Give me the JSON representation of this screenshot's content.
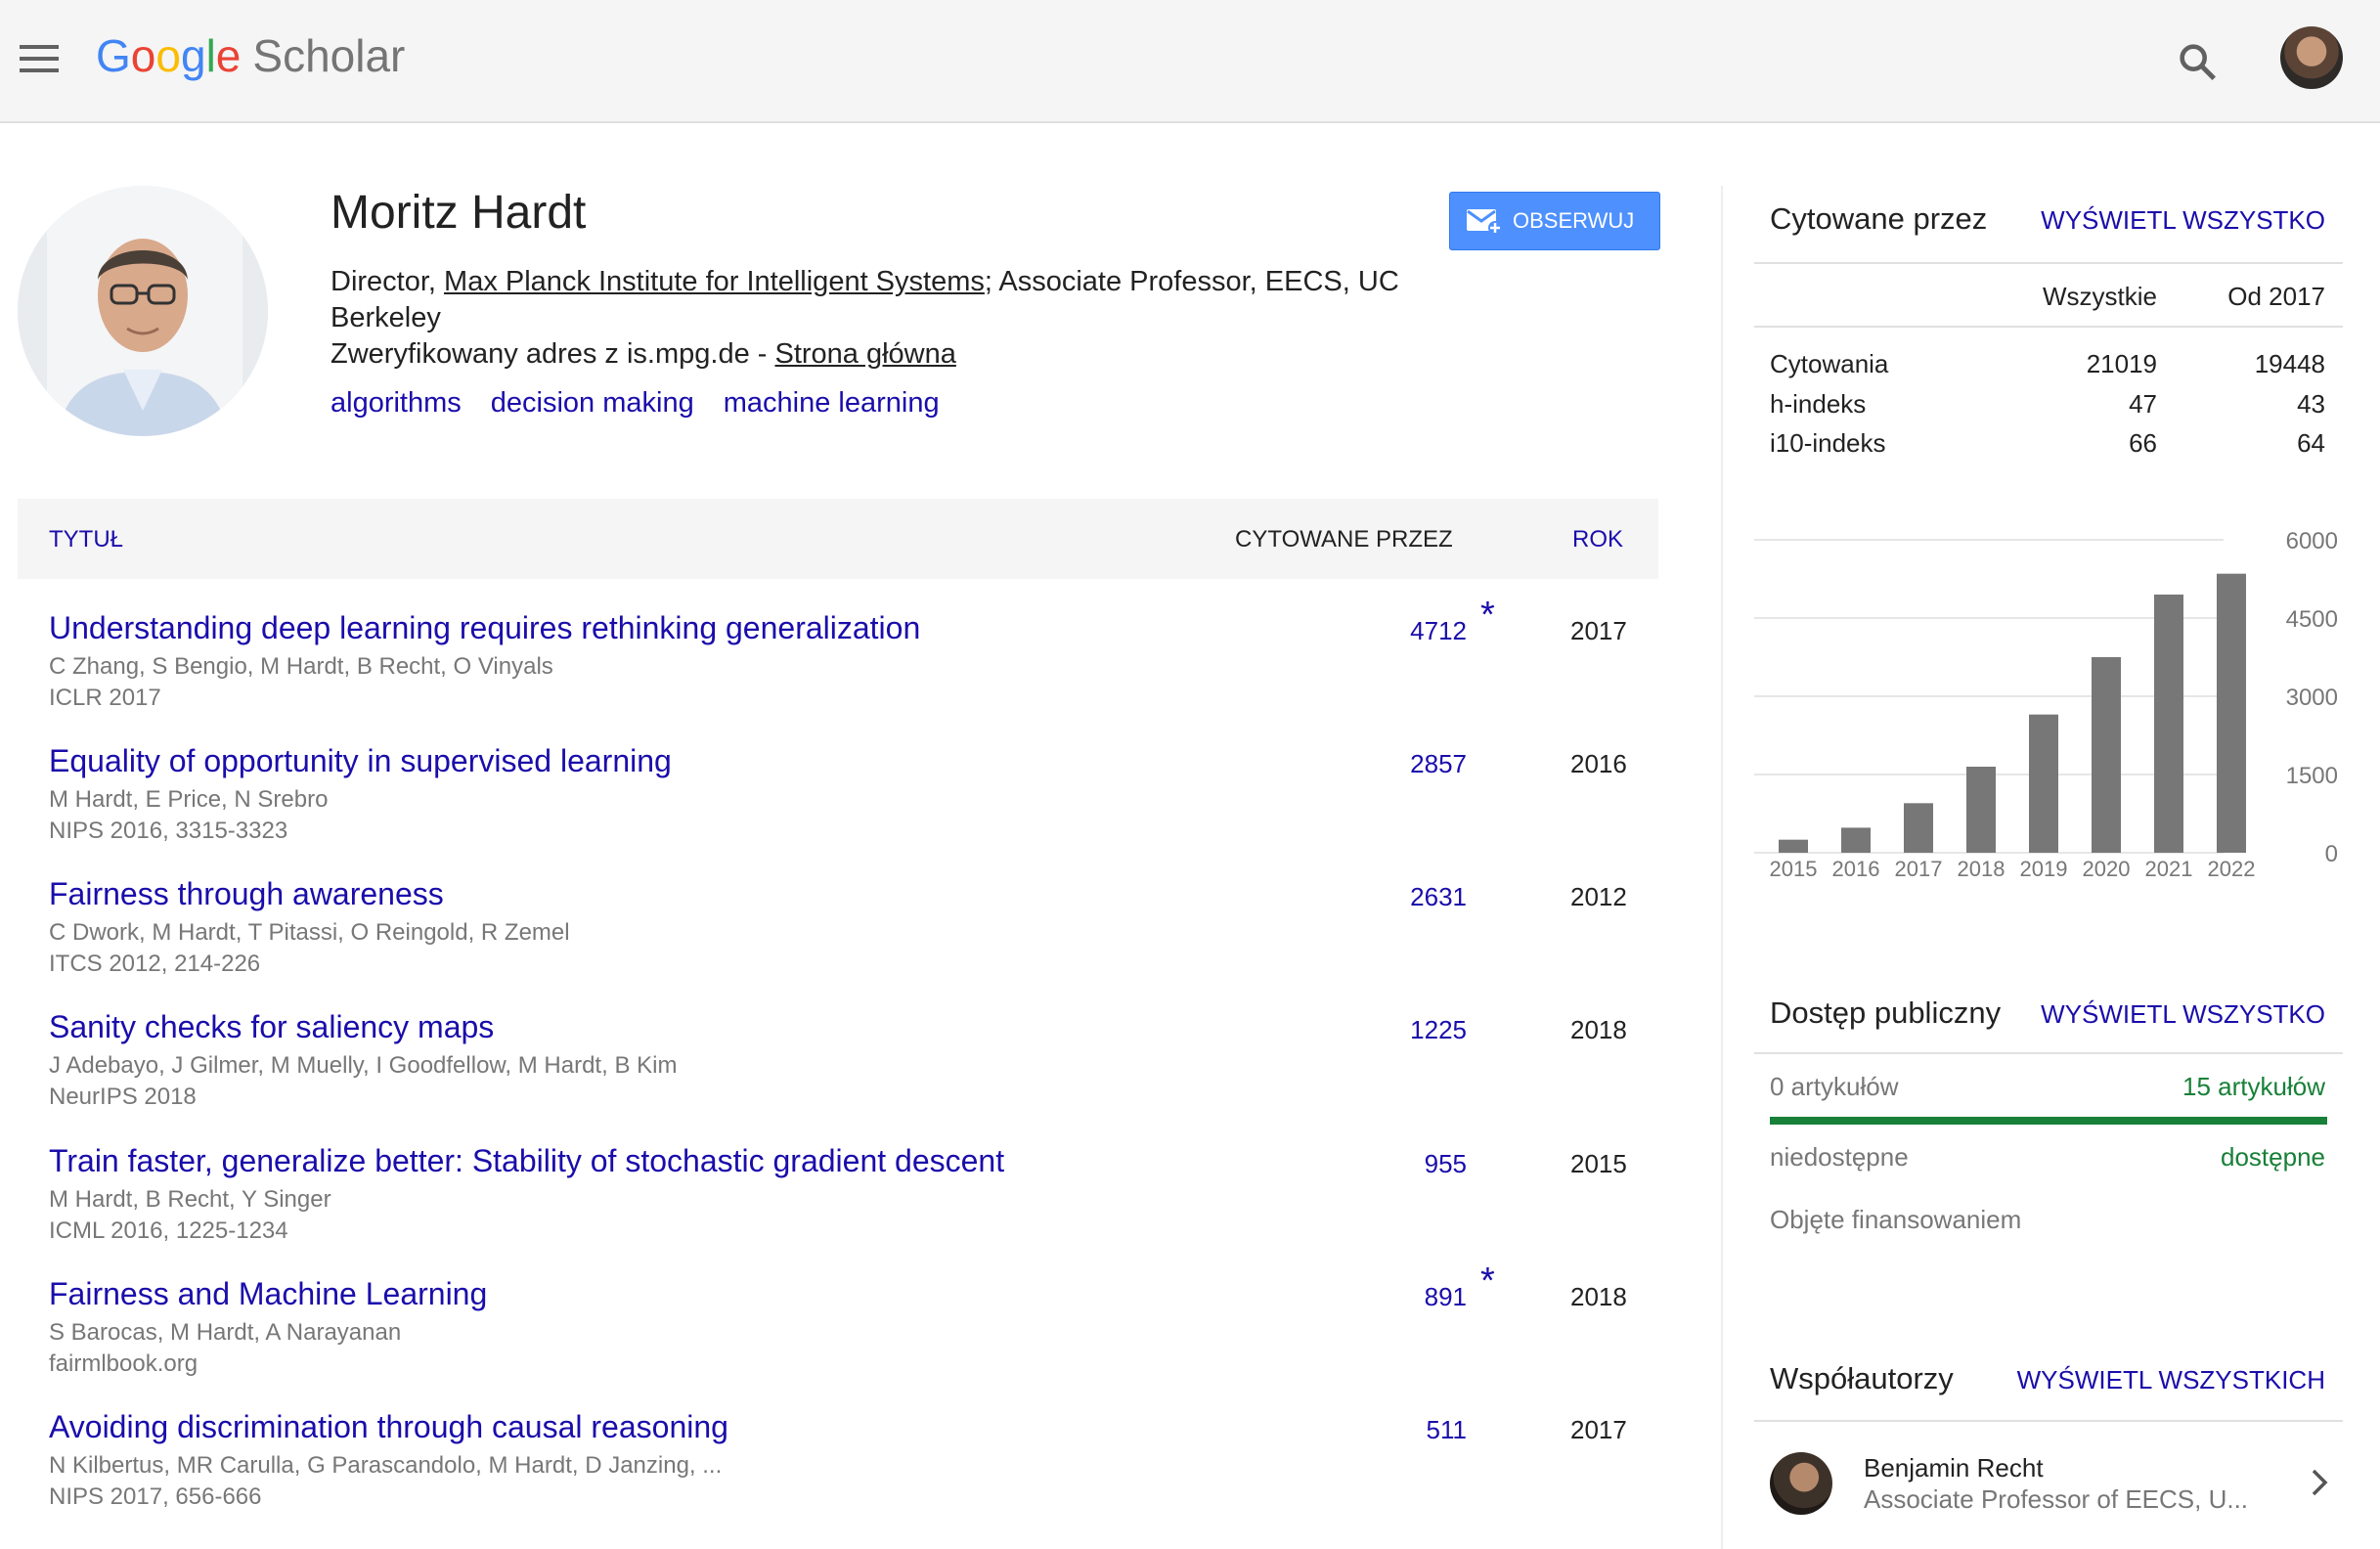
{
  "header": {
    "logo": [
      "G",
      "o",
      "o",
      "g",
      "l",
      "e"
    ],
    "logo_suffix": "Scholar"
  },
  "profile": {
    "name": "Moritz Hardt",
    "affil_prefix": "Director, ",
    "affil_link": "Max Planck Institute for Intelligent Systems",
    "affil_suffix": "; Associate Professor, EECS, UC Berkeley",
    "verified_text": "Zweryfikowany adres z is.mpg.de - ",
    "homepage_link": "Strona główna",
    "interests": [
      "algorithms",
      "decision making",
      "machine learning"
    ],
    "follow_label": "OBSERWUJ"
  },
  "table": {
    "col_title": "TYTUŁ",
    "col_cited": "CYTOWANE PRZEZ",
    "col_year": "ROK",
    "rows": [
      {
        "title": "Understanding deep learning requires rethinking generalization",
        "authors": "C Zhang, S Bengio, M Hardt, B Recht, O Vinyals",
        "venue": "ICLR 2017",
        "cited": "4712",
        "star": "*",
        "year": "2017"
      },
      {
        "title": "Equality of opportunity in supervised learning",
        "authors": "M Hardt, E Price, N Srebro",
        "venue": "NIPS 2016, 3315-3323",
        "cited": "2857",
        "star": "",
        "year": "2016"
      },
      {
        "title": "Fairness through awareness",
        "authors": "C Dwork, M Hardt, T Pitassi, O Reingold, R Zemel",
        "venue": "ITCS 2012, 214-226",
        "cited": "2631",
        "star": "",
        "year": "2012"
      },
      {
        "title": "Sanity checks for saliency maps",
        "authors": "J Adebayo, J Gilmer, M Muelly, I Goodfellow, M Hardt, B Kim",
        "venue": "NeurIPS 2018",
        "cited": "1225",
        "star": "",
        "year": "2018"
      },
      {
        "title": "Train faster, generalize better: Stability of stochastic gradient descent",
        "authors": "M Hardt, B Recht, Y Singer",
        "venue": "ICML 2016, 1225-1234",
        "cited": "955",
        "star": "",
        "year": "2015"
      },
      {
        "title": "Fairness and Machine Learning",
        "authors": "S Barocas, M Hardt, A Narayanan",
        "venue": "fairmlbook.org",
        "cited": "891",
        "star": "*",
        "year": "2018"
      },
      {
        "title": "Avoiding discrimination through causal reasoning",
        "authors": "N Kilbertus, MR Carulla, G Parascandolo, M Hardt, D Janzing, ...",
        "venue": "NIPS 2017, 656-666",
        "cited": "511",
        "star": "",
        "year": "2017"
      }
    ]
  },
  "cited_by": {
    "heading": "Cytowane przez",
    "view_all": "WYŚWIETL WSZYSTKO",
    "col_all": "Wszystkie",
    "col_since": "Od 2017",
    "stats": [
      {
        "label": "Cytowania",
        "all": "21019",
        "since": "19448"
      },
      {
        "label": "h-indeks",
        "all": "47",
        "since": "43"
      },
      {
        "label": "i10-indeks",
        "all": "66",
        "since": "64"
      }
    ]
  },
  "chart_data": {
    "type": "bar",
    "categories": [
      "2015",
      "2016",
      "2017",
      "2018",
      "2019",
      "2020",
      "2021",
      "2022"
    ],
    "values": [
      250,
      480,
      950,
      1650,
      2650,
      3750,
      4950,
      5350
    ],
    "ylim": [
      0,
      6000
    ],
    "yticks": [
      "6000",
      "4500",
      "3000",
      "1500",
      "0"
    ],
    "bar_color": "#777777",
    "grid": true
  },
  "open_access": {
    "heading": "Dostęp publiczny",
    "view_all": "WYŚWIETL WSZYSTKO",
    "left_count": "0 artykułów",
    "right_count": "15 artykułów",
    "left_label": "niedostępne",
    "right_label": "dostępne",
    "funding": "Objęte finansowaniem",
    "accent": "#188038"
  },
  "coauthors": {
    "heading": "Współautorzy",
    "view_all": "WYŚWIETL WSZYSTKICH",
    "items": [
      {
        "name": "Benjamin Recht",
        "affiliation": "Associate Professor of EECS, U..."
      }
    ]
  }
}
